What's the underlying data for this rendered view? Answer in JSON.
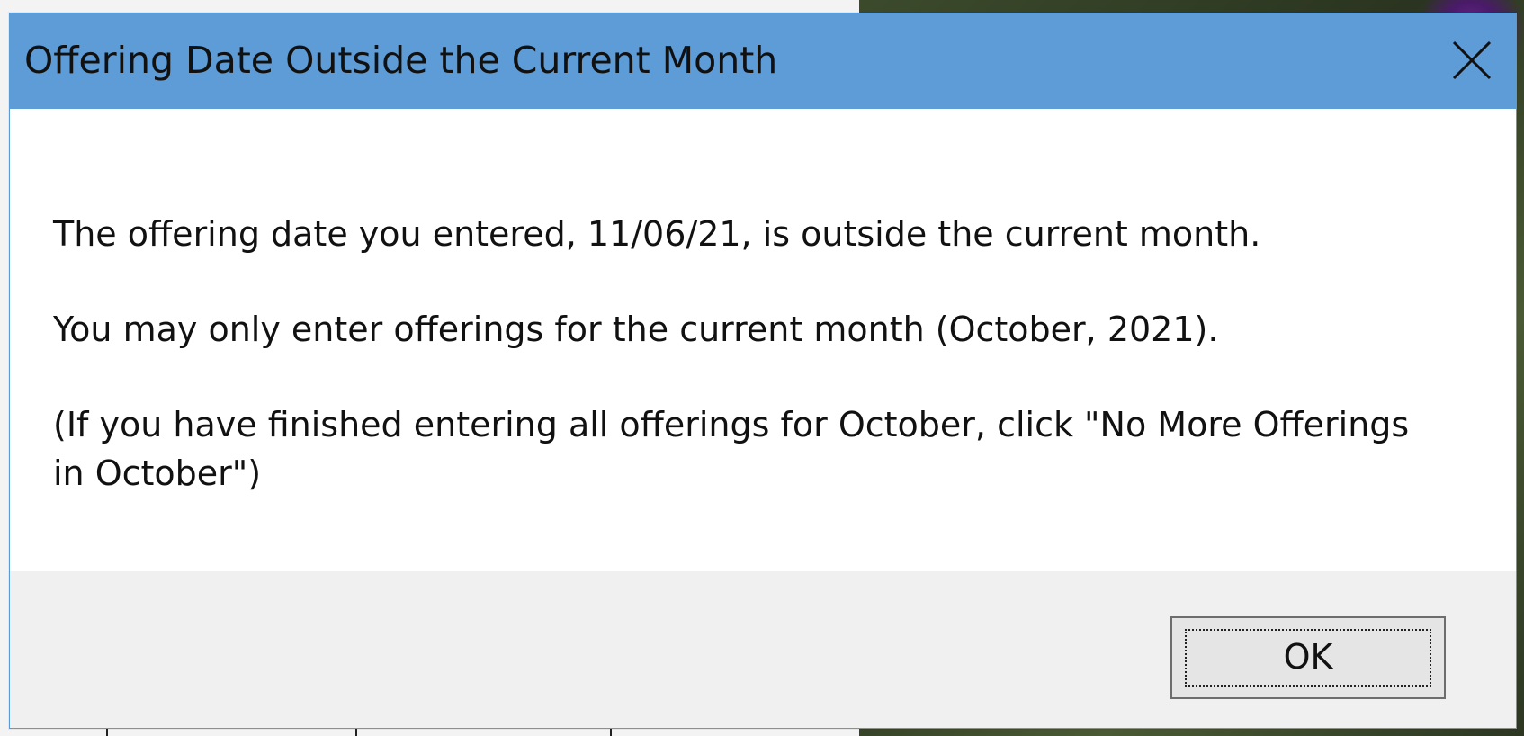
{
  "dialog": {
    "title": "Offering Date Outside the Current Month",
    "messages": [
      "The offering date you entered, 11/06/21, is outside the current month.",
      "You may only enter offerings for the current month (October, 2021).",
      "(If you have finished entering all offerings for October, click \"No More Offerings in October\")"
    ],
    "ok_label": "OK",
    "close_icon": "close-icon"
  },
  "colors": {
    "titlebar": "#5d9cd7",
    "content_bg": "#ffffff",
    "footer_bg": "#f0f0f0",
    "button_bg": "#e5e5e5"
  }
}
